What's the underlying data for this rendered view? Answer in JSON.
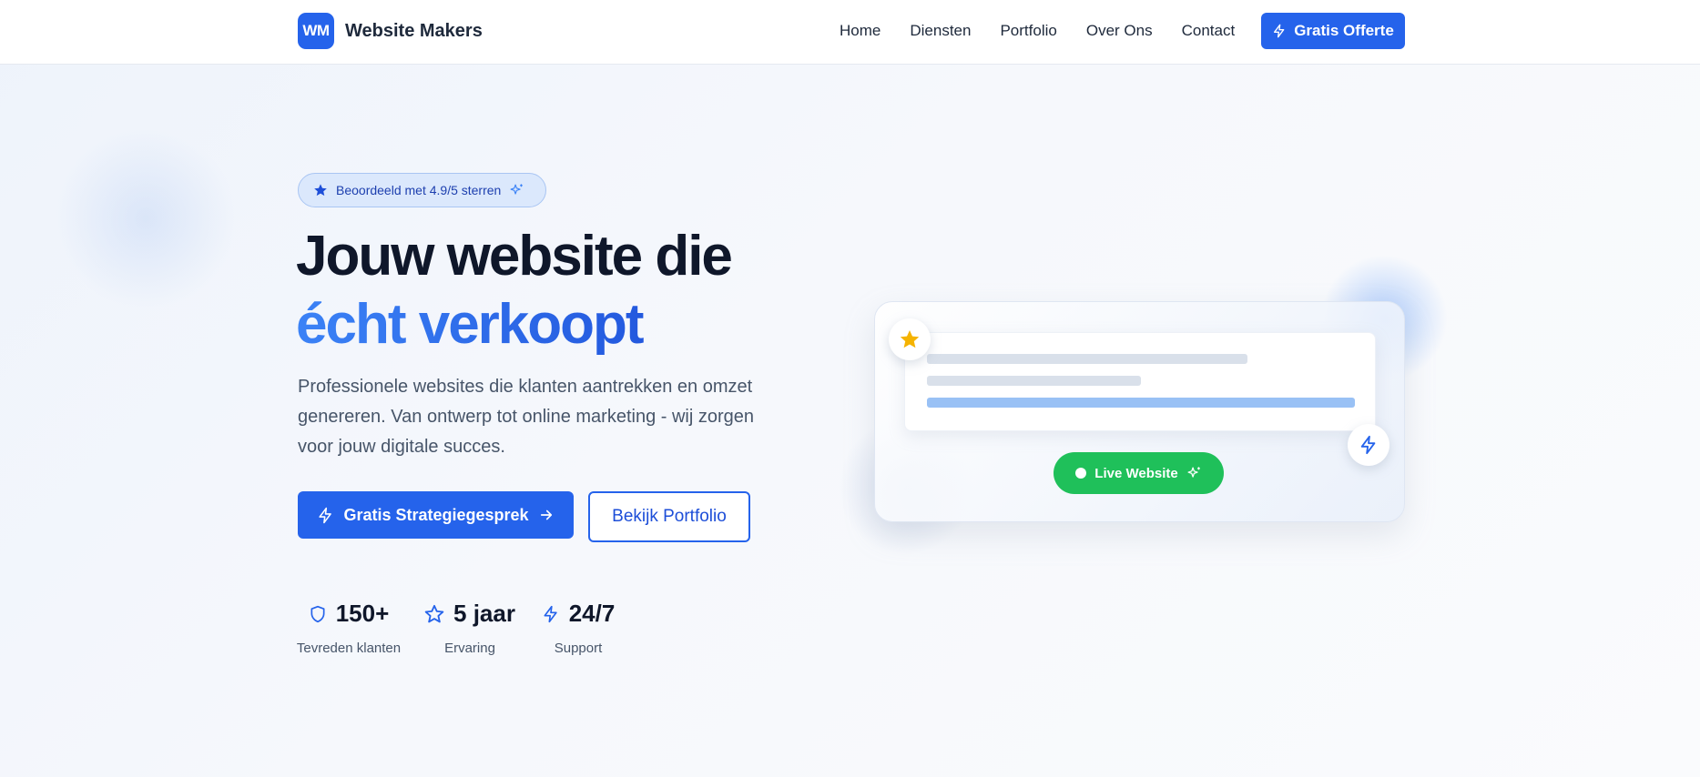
{
  "nav": {
    "logo_text": "WM",
    "brand_name": "Website Makers",
    "links": [
      "Home",
      "Diensten",
      "Portfolio",
      "Over Ons",
      "Contact"
    ],
    "cta_label": "Gratis Offerte"
  },
  "hero": {
    "rating_badge": "Beoordeeld met 4.9/5 sterren",
    "headline_line1": "Jouw website die",
    "headline_line2": "écht verkoopt",
    "description": "Professionele websites die klanten aantrekken en omzet genereren. Van ontwerp tot online marketing - wij zorgen voor jouw digitale succes.",
    "primary_button": "Gratis Strategiegesprek",
    "secondary_button": "Bekijk Portfolio",
    "stats": [
      {
        "value": "150+",
        "label": "Tevreden klanten",
        "icon": "shield-icon"
      },
      {
        "value": "5 jaar",
        "label": "Ervaring",
        "icon": "star-icon"
      },
      {
        "value": "24/7",
        "label": "Support",
        "icon": "bolt-icon"
      }
    ]
  },
  "preview_card": {
    "live_label": "Live Website"
  },
  "colors": {
    "primary": "#2563eb",
    "heading": "#0f172a",
    "live_green": "#1fc05a",
    "star_gold": "#f5b301"
  }
}
